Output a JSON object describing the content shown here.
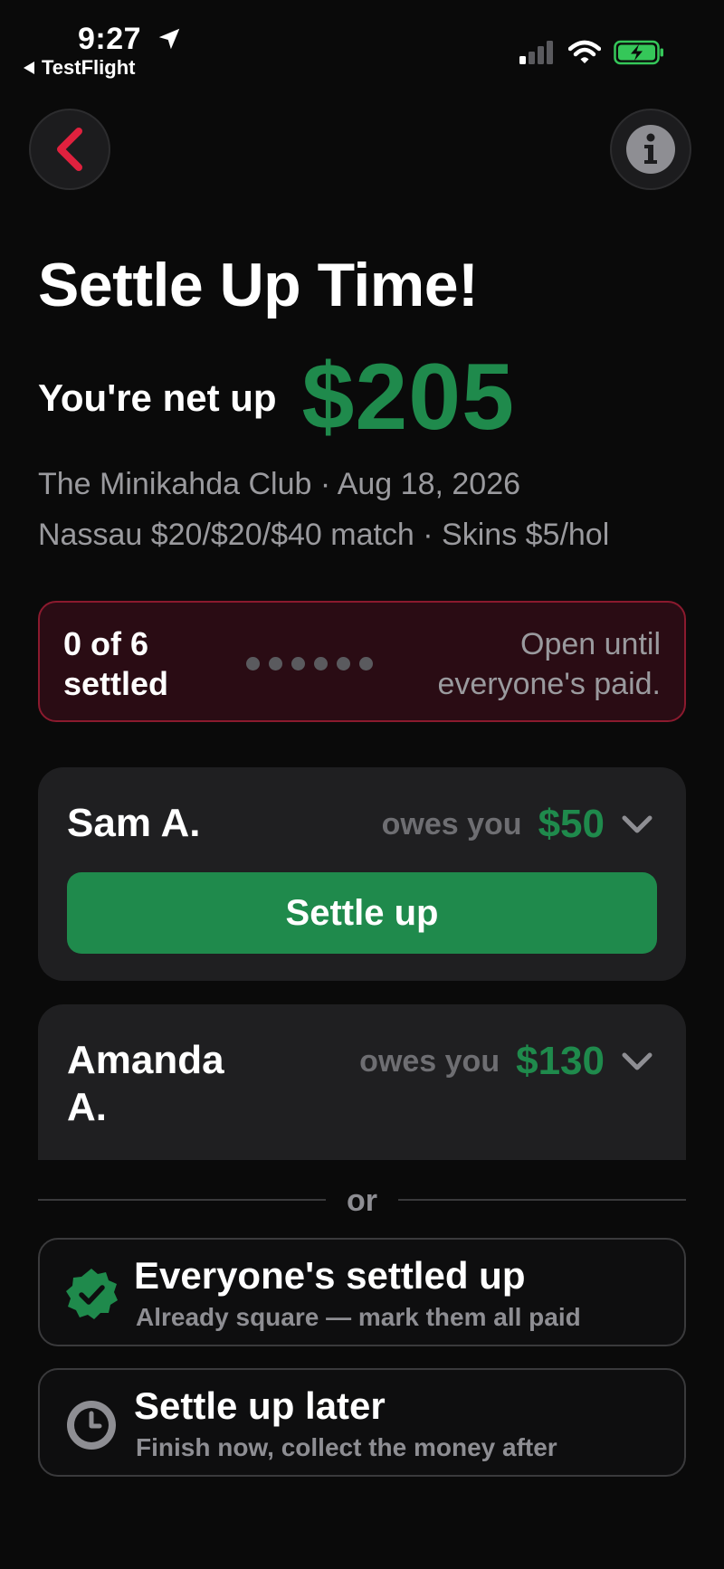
{
  "status_bar": {
    "time": "9:27",
    "back_app": "TestFlight"
  },
  "header": {
    "back_icon": "chevron-left-icon",
    "info_icon": "info-icon",
    "title": "Settle Up Time!"
  },
  "summary": {
    "net_label": "You're net up",
    "net_amount": "$205",
    "course_line": "The Minikahda Club · Aug 18, 2026",
    "game_line": "Nassau $20/$20/$40 match · Skins $5/hol"
  },
  "progress": {
    "count_line1": "0 of 6",
    "count_line2": "settled",
    "settled": 0,
    "total": 6,
    "note_line1": "Open until",
    "note_line2": "everyone's paid."
  },
  "players": [
    {
      "name": "Sam A.",
      "owes_label": "owes you",
      "amount": "$50",
      "button_label": "Settle up"
    },
    {
      "name_line1": "Amanda",
      "name_line2": "A.",
      "owes_label": "owes you",
      "amount": "$130"
    }
  ],
  "divider": {
    "label": "or"
  },
  "options": [
    {
      "title": "Everyone's settled up",
      "subtitle": "Already square — mark them all paid",
      "icon": "verified-check-icon"
    },
    {
      "title": "Settle up later",
      "subtitle": "Finish now, collect the money after",
      "icon": "clock-icon"
    }
  ],
  "colors": {
    "accent_green": "#1f8a4c",
    "back_red": "#e0213e",
    "banner_border": "#8b1a2e",
    "banner_bg": "#2a0c14",
    "battery_green": "#35c759"
  }
}
